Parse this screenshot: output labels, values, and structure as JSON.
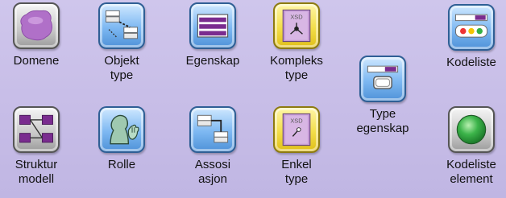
{
  "items": [
    {
      "line1": "Domene",
      "line2": ""
    },
    {
      "line1": "Objekt",
      "line2": "type"
    },
    {
      "line1": "Egenskap",
      "line2": ""
    },
    {
      "line1": "Kompleks",
      "line2": "type"
    },
    {
      "line1": "Type",
      "line2": "egenskap"
    },
    {
      "line1": "Kodeliste",
      "line2": ""
    },
    {
      "line1": "Struktur",
      "line2": "modell"
    },
    {
      "line1": "Rolle",
      "line2": ""
    },
    {
      "line1": "Assosi",
      "line2": "asjon"
    },
    {
      "line1": "Enkel",
      "line2": "type"
    },
    {
      "line1": "Kodeliste",
      "line2": "element"
    }
  ],
  "xsd_badge": "XSD",
  "icons": [
    "blob-icon",
    "object-type-icon",
    "property-icon",
    "xsd-complex-icon",
    "type-property-icon",
    "codelist-icon",
    "structure-model-icon",
    "role-icon",
    "association-icon",
    "xsd-simple-icon",
    "codelist-element-icon"
  ]
}
